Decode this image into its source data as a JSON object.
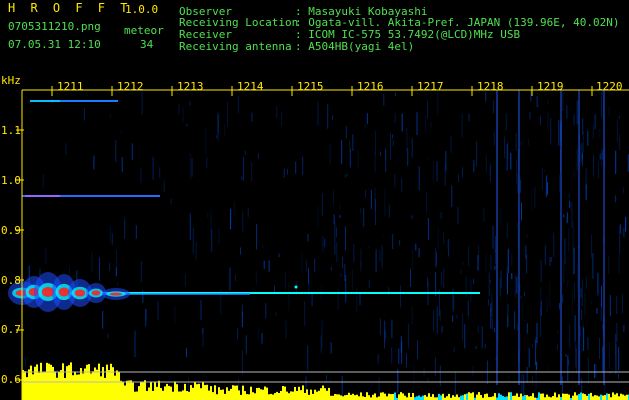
{
  "app": {
    "title": "H R O F F T",
    "version": "1.0.0"
  },
  "file": {
    "name": "0705311210.png",
    "datetime": "07.05.31 12:10"
  },
  "meteor": {
    "label": "meteor",
    "count": "34"
  },
  "info": {
    "labels": [
      "Observer",
      "Receiving Location",
      "Receiver",
      "Receiving antenna"
    ],
    "values": [
      ": Masayuki Kobayashi",
      ": Ogata-vill. Akita-Pref. JAPAN (139.96E, 40.02N)",
      ": ICOM IC-575 53.7492(@LCD)MHz USB",
      ": A504HB(yagi 4el)"
    ]
  },
  "axis": {
    "unit": "kHz",
    "y_ticks": [
      "1.1",
      "1.0",
      "0.9",
      "0.8",
      "0.7",
      "0.6"
    ],
    "x_ticks": [
      "1211",
      "1212",
      "1213",
      "1214",
      "1215",
      "1216",
      "1217",
      "1218",
      "1219",
      "1220"
    ]
  },
  "colors": {
    "header_text": "#4fe04f",
    "highlight_text": "#ffe800",
    "background": "#000000",
    "echo_main": "#00ffff",
    "echo_hot": "#ff2020",
    "level": "#ffff00"
  }
}
